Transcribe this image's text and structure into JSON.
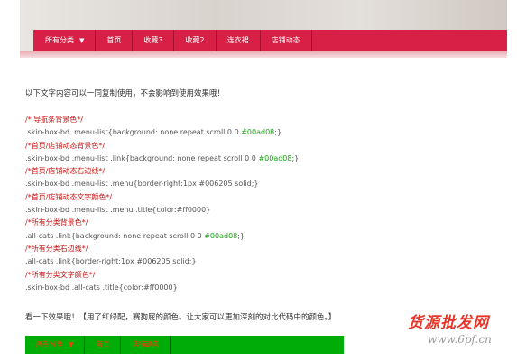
{
  "top_nav": {
    "items": [
      "所有分类",
      "首页",
      "收藏3",
      "收藏2",
      "连衣裙",
      "店铺动态"
    ],
    "caret": "▼",
    "bg_color": "#d81f45"
  },
  "intro_text": "以下文字内容可以一同复制使用，不会影响到使用效果哦！",
  "code_lines": [
    {
      "type": "comment",
      "text": "/* 导航条背景色*/"
    },
    {
      "type": "css",
      "text": ".skin-box-bd .menu-list{background: none repeat scroll 0 0 ",
      "hl": "#00ad08",
      "after": ";}"
    },
    {
      "type": "comment",
      "text": "/*首页/店铺动态背景色*/"
    },
    {
      "type": "css",
      "text": ".skin-box-bd .menu-list .link{background: none repeat scroll 0 0 ",
      "hl": "#00ad08",
      "after": ";}"
    },
    {
      "type": "comment",
      "text": "/*首页/店铺动态右边线*/"
    },
    {
      "type": "css",
      "text": ".skin-box-bd .menu-list .menu{border-right:1px #006205 solid;}"
    },
    {
      "type": "comment",
      "text": "/*首页/店铺动态文字颜色*/"
    },
    {
      "type": "css",
      "text": ".skin-box-bd .menu-list .menu .title{color:#ff0000}"
    },
    {
      "type": "comment",
      "text": "/*所有分类背景色*/"
    },
    {
      "type": "css",
      "text": ".all-cats .link{background: none repeat scroll 0 0 ",
      "hl": "#00ad08",
      "after": ";}"
    },
    {
      "type": "comment",
      "text": "/*所有分类右边线*/"
    },
    {
      "type": "css",
      "text": ".all-cats .link{border-right:1px #006205 solid;}"
    },
    {
      "type": "comment",
      "text": "/*所有分类文字颜色*/"
    },
    {
      "type": "css",
      "text": ".skin-box-bd .all-cats .title{color:#ff0000}"
    }
  ],
  "result_text": "看一下效果哦！【用了红绿配，赛狗屁的颜色。让大家可以更加深刻的对比代码中的颜色。】",
  "bottom_nav": {
    "items": [
      "所有分类",
      "首页",
      "店铺动态"
    ],
    "caret": "▼",
    "bg_color": "#00ad08",
    "text_color": "#ff0000"
  },
  "watermark": {
    "title": "货源批发网",
    "url": "www.6pf.cn"
  }
}
